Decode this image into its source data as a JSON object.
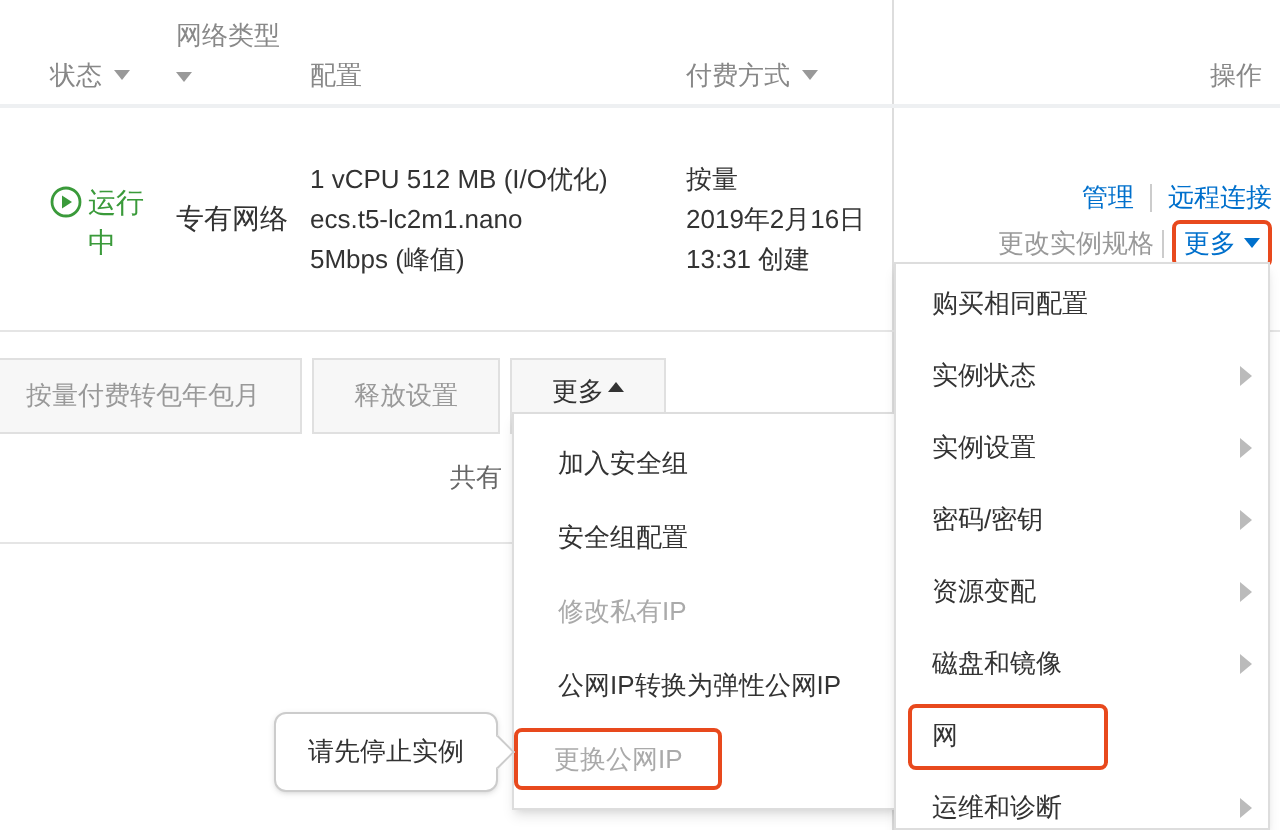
{
  "table": {
    "columns": [
      {
        "label": "状态",
        "sortable": true
      },
      {
        "label": "网络类型",
        "sortable": true
      },
      {
        "label": "配置",
        "sortable": false
      },
      {
        "label": "付费方式",
        "sortable": true
      },
      {
        "label": "操作",
        "sortable": false
      }
    ],
    "row": {
      "status": "运行中",
      "network": "专有网络",
      "config": [
        "1 vCPU 512 MB (I/O优化)",
        "ecs.t5-lc2m1.nano",
        "5Mbps (峰值)"
      ],
      "billing": [
        "按量",
        "2019年2月16日",
        "13:31 创建"
      ],
      "actions": [
        {
          "label": "管理",
          "kind": "link"
        },
        {
          "label": "远程连接",
          "kind": "link"
        },
        {
          "label": "更改实例规格",
          "kind": "muted"
        },
        {
          "label": "更多",
          "kind": "more",
          "highlighted": true
        }
      ]
    }
  },
  "toolbar": {
    "buttons": [
      {
        "label": "按量付费转包年包月",
        "kind": "button"
      },
      {
        "label": "释放设置",
        "kind": "button"
      },
      {
        "label": "更多",
        "kind": "dropdown"
      }
    ],
    "summary": "共有"
  },
  "more_menu": [
    {
      "label": "加入安全组",
      "disabled": false,
      "highlighted": false
    },
    {
      "label": "安全组配置",
      "disabled": false,
      "highlighted": false
    },
    {
      "label": "修改私有IP",
      "disabled": true,
      "highlighted": false
    },
    {
      "label": "公网IP转换为弹性公网IP",
      "disabled": false,
      "highlighted": false
    },
    {
      "label": "更换公网IP",
      "disabled": true,
      "highlighted": true
    }
  ],
  "tooltip": "请先停止实例",
  "row_menu": [
    {
      "label": "购买相同配置",
      "submenu": false,
      "highlighted": false
    },
    {
      "label": "实例状态",
      "submenu": true,
      "highlighted": false
    },
    {
      "label": "实例设置",
      "submenu": true,
      "highlighted": false
    },
    {
      "label": "密码/密钥",
      "submenu": true,
      "highlighted": false
    },
    {
      "label": "资源变配",
      "submenu": true,
      "highlighted": false
    },
    {
      "label": "磁盘和镜像",
      "submenu": true,
      "highlighted": false
    },
    {
      "label": "网",
      "submenu": false,
      "highlighted": true
    },
    {
      "label": "运维和诊断",
      "submenu": true,
      "highlighted": false
    }
  ]
}
